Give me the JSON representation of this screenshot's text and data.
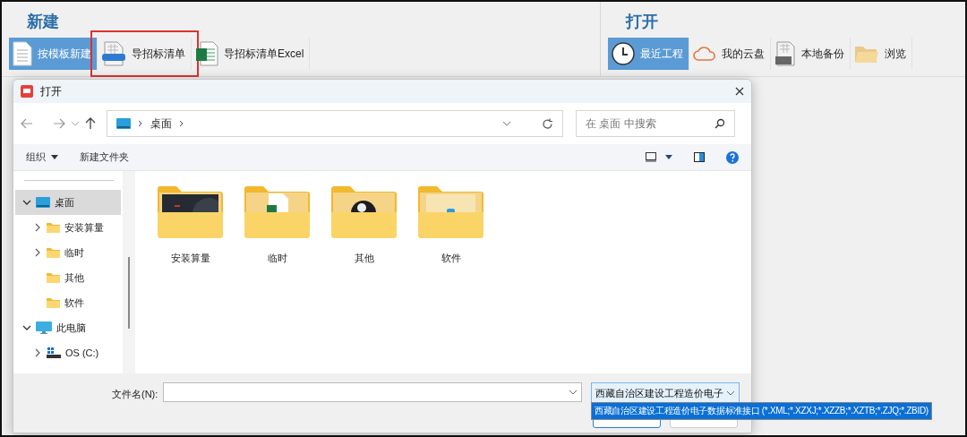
{
  "ribbon": {
    "sections": [
      {
        "title": "新建",
        "buttons": [
          {
            "label": "按模板新建",
            "kind": "document",
            "selected": true,
            "highlighted": false
          },
          {
            "label": "导招标清单",
            "kind": "xml",
            "selected": false,
            "highlighted": true
          },
          {
            "label": "导招标清单Excel",
            "kind": "excel",
            "selected": false,
            "highlighted": false
          }
        ]
      },
      {
        "title": "打开",
        "buttons": [
          {
            "label": "最近工程",
            "kind": "clock",
            "selected": true,
            "highlighted": false
          },
          {
            "label": "我的云盘",
            "kind": "cloud",
            "selected": false,
            "highlighted": false
          },
          {
            "label": "本地备份",
            "kind": "bak",
            "selected": false,
            "highlighted": false
          },
          {
            "label": "浏览",
            "kind": "folder",
            "selected": false,
            "highlighted": false
          }
        ]
      }
    ]
  },
  "dialog": {
    "title": "打开",
    "address": {
      "crumbs": [
        "桌面"
      ]
    },
    "search": {
      "placeholder": "在 桌面 中搜索"
    },
    "commands": [
      {
        "label": "组织",
        "kind": "menu"
      },
      {
        "label": "新建文件夹",
        "kind": "button"
      }
    ],
    "nav_tree": [
      {
        "label": "桌面",
        "kind": "desktop",
        "selected": true,
        "expanded": true,
        "children": [
          {
            "label": "安装算量",
            "kind": "folder",
            "selected": false,
            "expanded": false
          },
          {
            "label": "临时",
            "kind": "folder",
            "selected": false,
            "expanded": false
          },
          {
            "label": "其他",
            "kind": "folder",
            "selected": false
          },
          {
            "label": "软件",
            "kind": "folder",
            "selected": false
          }
        ]
      },
      {
        "label": "此电脑",
        "kind": "computer",
        "selected": false,
        "expanded": true,
        "children": [
          {
            "label": "OS (C:)",
            "kind": "drive",
            "selected": false,
            "expanded": false
          }
        ]
      }
    ],
    "files": [
      {
        "name": "安装算量",
        "kind": "dark"
      },
      {
        "name": "临时",
        "kind": "excel"
      },
      {
        "name": "其他",
        "kind": "circle"
      },
      {
        "name": "软件",
        "kind": "blue"
      }
    ],
    "filename": {
      "label": "文件名(N):"
    },
    "filetype": {
      "value": "西藏自治区建设工程造价电子",
      "expanded": true,
      "options": [
        {
          "label": "西藏自治区建设工程造价电子数据标准接口 (*.XML;*.XZXJ;*.XZZB;*.XZTB;*.ZJQ;*.ZBID)",
          "selected": true
        }
      ]
    },
    "action_buttons": [
      {
        "kind": "primary"
      },
      {
        "kind": "secondary"
      }
    ]
  }
}
